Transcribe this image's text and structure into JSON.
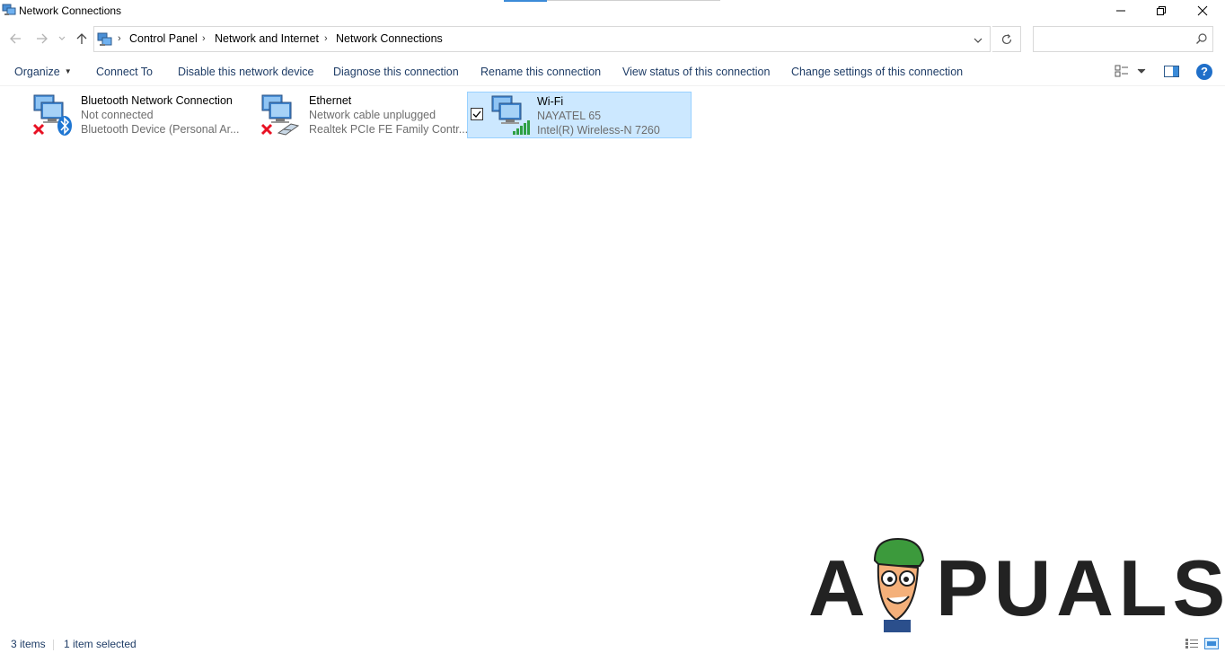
{
  "window": {
    "title": "Network Connections",
    "minimize_icon": "minimize-icon",
    "maximize_icon": "restore-icon",
    "close_icon": "close-icon"
  },
  "nav": {
    "back_icon": "back-arrow-icon",
    "forward_icon": "forward-arrow-icon",
    "recent_icon": "chevron-down-icon",
    "up_icon": "up-arrow-icon",
    "breadcrumb": [
      "Control Panel",
      "Network and Internet",
      "Network Connections"
    ],
    "refresh_icon": "refresh-icon",
    "search": {
      "value": "",
      "placeholder": ""
    }
  },
  "commands": {
    "organize": "Organize",
    "connect_to": "Connect To",
    "disable": "Disable this network device",
    "diagnose": "Diagnose this connection",
    "rename": "Rename this connection",
    "view_status": "View status of this connection",
    "change_settings": "Change settings of this connection",
    "help": "?"
  },
  "connections": [
    {
      "name": "Bluetooth Network Connection",
      "status": "Not connected",
      "device": "Bluetooth Device (Personal Ar...",
      "selected": false
    },
    {
      "name": "Ethernet",
      "status": "Network cable unplugged",
      "device": "Realtek PCIe FE Family Contr...",
      "selected": false
    },
    {
      "name": "Wi-Fi",
      "status": "NAYATEL 65",
      "device": "Intel(R) Wireless-N 7260",
      "selected": true
    }
  ],
  "watermark": {
    "text": "A PUALS",
    "left": "A",
    "right": "PUALS"
  },
  "statusbar": {
    "items_count": "3 items",
    "selected_count": "1 item selected"
  },
  "colors": {
    "accent": "#3b8bd8",
    "selection_bg": "#cce8ff",
    "selection_border": "#99d1ff",
    "link_text": "#1e3c66",
    "error_red": "#e81123",
    "bluetooth_blue": "#1f76d2",
    "signal_green": "#2ea043"
  }
}
